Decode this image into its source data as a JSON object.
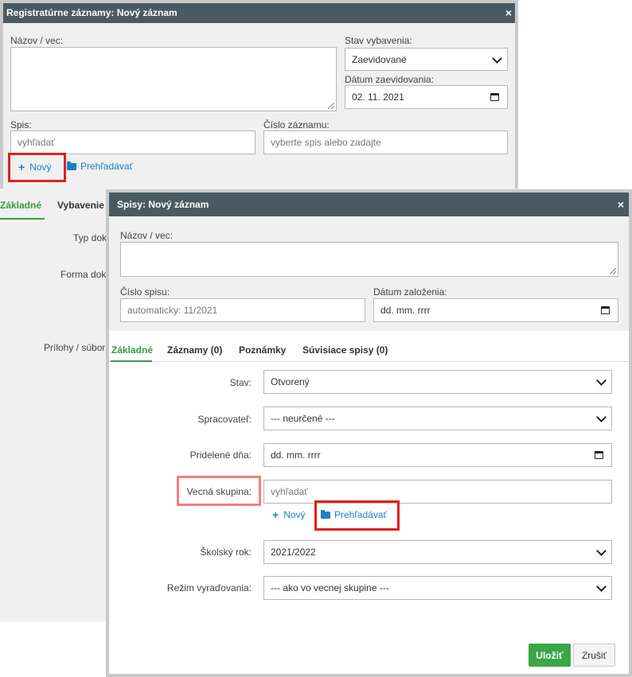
{
  "back_dialog": {
    "title": "Registratúrne záznamy: Nový záznam",
    "close_icon": "×",
    "name_label": "Názov / vec:",
    "status_label": "Stav vybavenia:",
    "status_value": "Zaevidované",
    "date_label": "Dátum zaevidovania:",
    "date_value": "02. 11. 2021",
    "file_label": "Spis:",
    "file_placeholder": "vyhľadať",
    "record_no_label": "Číslo záznamu:",
    "record_no_placeholder": "vyberte spis alebo zadajte",
    "new_link": "Nový",
    "browse_link": "Prehľadávať",
    "tabs": [
      "Základné",
      "Vybavenie"
    ],
    "side_labels": [
      "Typ dok",
      "Forma dok",
      "Prílohy / súbor"
    ]
  },
  "front_dialog": {
    "title": "Spisy: Nový záznam",
    "close_icon": "×",
    "name_label": "Názov / vec:",
    "file_no_label": "Číslo spisu:",
    "file_no_placeholder": "automaticky: 11/2021",
    "created_label": "Dátum založenia:",
    "created_value": "dd. mm. rrrr",
    "tabs": [
      "Základné",
      "Záznamy (0)",
      "Poznámky",
      "Súvisiace spisy (0)"
    ],
    "rows": {
      "stav_label": "Stav:",
      "stav_value": "Otvorený",
      "spracovatel_label": "Spracovateľ:",
      "spracovatel_value": "--- neurčené ---",
      "pridelene_label": "Pridelené dňa:",
      "pridelene_value": "dd. mm. rrrr",
      "skupina_label": "Vecná skupina:",
      "skupina_placeholder": "vyhľadať",
      "new_link": "Nový",
      "browse_link": "Prehľadávať",
      "rok_label": "Školský rok:",
      "rok_value": "2021/2022",
      "rezim_label": "Režim vyraďovania:",
      "rezim_value": "--- ako vo vecnej skupine ---"
    },
    "save_button": "Uložiť",
    "cancel_button": "Zrušiť"
  },
  "colors": {
    "titlebar": "#4a5a63",
    "active_tab": "#3a9a45",
    "link": "#1f7fc7",
    "highlight_red": "#e02020",
    "highlight_pink": "#f08080",
    "save_button": "#3aa648"
  },
  "icons": {
    "close": "close-icon",
    "plus": "plus-icon",
    "folder": "folder-open-icon",
    "select": "chevron-down-icon",
    "calendar": "calendar-icon"
  }
}
